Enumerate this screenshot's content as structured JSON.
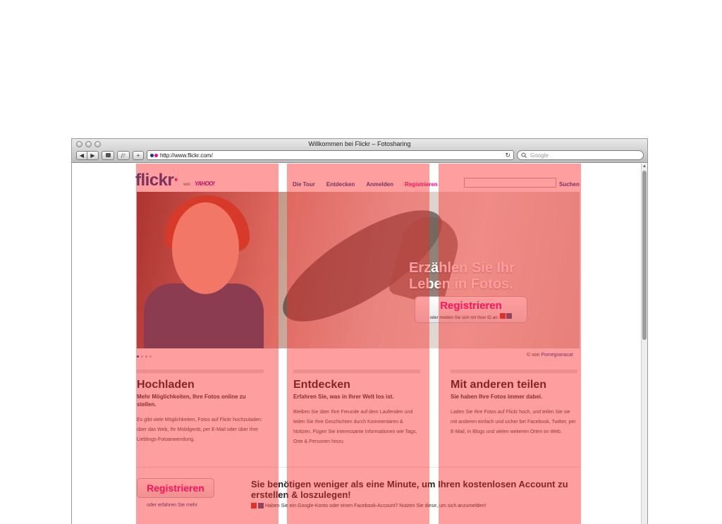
{
  "browser": {
    "window_title": "Willkommen bei Flickr – Fotosharing",
    "url": "http://www.flickr.com/",
    "search_placeholder": "Google",
    "back_glyph": "◀",
    "forward_glyph": "▶",
    "add_glyph": "+",
    "reload_glyph": "↻",
    "icons": [
      "back-icon",
      "forward-icon",
      "ublock-icon",
      "snapback-icon",
      "add-bookmark-icon",
      "reload-icon",
      "magnifier-icon"
    ]
  },
  "header": {
    "logo_text": "flickr",
    "logo_by": "von",
    "logo_yahoo": "YAHOO!",
    "nav": [
      {
        "label": "Die Tour"
      },
      {
        "label": "Entdecken"
      },
      {
        "label": "Anmelden"
      },
      {
        "label": "Registrieren"
      }
    ],
    "search_button": "Suchen"
  },
  "hero": {
    "tagline_line1": "Erzählen Sie Ihr",
    "tagline_line2": "Leben in Fotos.",
    "register_label": "Registrieren",
    "register_sub": "oder melden Sie sich mit Ihrer ID an:",
    "credit_prefix": "© von",
    "credit_author": "Pomegranacat"
  },
  "columns": [
    {
      "title": "Hochladen",
      "subtitle": "Mehr Möglichkeiten, Ihre Fotos online zu stellen.",
      "body": "Es gibt viele Möglichkeiten, Fotos auf Flickr hochzuladen: über das Web, Ihr Mobilgerät, per E-Mail oder über Ihre Lieblings-Fotoanwendung."
    },
    {
      "title": "Entdecken",
      "subtitle": "Erfahren Sie, was in Ihrer Welt los ist.",
      "body": "Bleiben Sie über Ihre Freunde auf dem Laufenden und teilen Sie Ihre Geschichten durch Kommentaren & Notizen. Fügen Sie interessante Informationen wie Tags, Orte & Personen hinzu."
    },
    {
      "title": "Mit anderen teilen",
      "subtitle": "Sie haben Ihre Fotos immer dabei.",
      "body": "Laden Sie Ihre Fotos auf Flickr hoch, und teilen Sie sie mit anderen einfach und sicher bei Facebook, Twitter, per E-Mail, in Blogs und vielen weiteren Orten im Web."
    }
  ],
  "bottom": {
    "register_label": "Registrieren",
    "learn_more": "oder erfahren Sie mehr",
    "cta": "Sie benötigen weniger als eine Minute, um Ihren kostenlosen Account zu erstellen & loszulegen!",
    "cta_sub": "Haben Sie ein Google-Konto oder einen Facebook-Account? Nutzen Sie diese, um sich anzumelden!"
  },
  "colors": {
    "overlay": "#ff2828",
    "flickr_blue": "#0c3a8a",
    "flickr_pink": "#ff0084"
  }
}
